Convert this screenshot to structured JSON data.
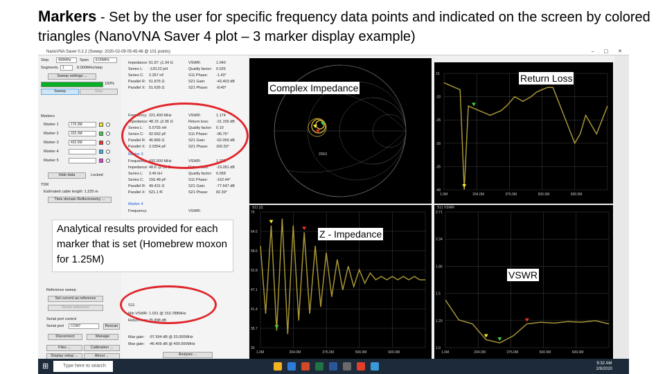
{
  "slide": {
    "title_bold": "Markers",
    "title_rest": " - Set by the user for specific frequency data points and indicated on the screen by colored triangles (NanoVNA Saver 4 plot – 3 marker display example)"
  },
  "window": {
    "title": "NanoVNA Saver 0.2.2 (Sweep: 2020-02-09 05:45:48 @ 101 points)",
    "controls": "– ▢ ✕"
  },
  "sweep_panel": {
    "stop_label": "Stop",
    "stop_value": "400MHz",
    "span_label": "Span",
    "span_value": "8.00MHz",
    "segments_label": "Segments",
    "segments_value": "1",
    "segment_info": "8.000MHz/step",
    "settings_button": "Sweep settings ...",
    "progress": "100%",
    "sweep_button": "Sweep",
    "stop_button": "Stop"
  },
  "markers_panel": {
    "title": "Markers",
    "items": [
      {
        "label": "Marker 1",
        "value": "170.3M",
        "color": "#f5e82a"
      },
      {
        "label": "Marker 2",
        "value": "222.3M",
        "color": "#3fd04a"
      },
      {
        "label": "Marker 3",
        "value": "432.5M",
        "color": "#e8352b"
      },
      {
        "label": "Marker 4",
        "value": "",
        "color": "#29b8e8"
      },
      {
        "label": "Marker 5",
        "value": "",
        "color": "#e83bd5"
      }
    ],
    "hide_button": "Hide data",
    "locked_label": "Locked"
  },
  "tdr_panel": {
    "title": "TDR",
    "cable_label": "Estimated cable length: 1.225 m",
    "time_button": "Time domain Reflectometry ..."
  },
  "reference_panel": {
    "title": "Reference sweep",
    "set_button": "Set current as reference",
    "reset_button": "Reset reference"
  },
  "serial_panel": {
    "title": "Serial port control",
    "port_label": "Serial port",
    "port_value": "COM7",
    "rescan_button": "Rescan",
    "disconnect_button": "Disconnect",
    "manage_button": "Manage"
  },
  "bottom_buttons": {
    "files": "Files ...",
    "calibration": "Calibration ...",
    "display": "Display setup ...",
    "about": "About ...",
    "analysis": "Analysis ..."
  },
  "marker_data": {
    "block1": [
      [
        "Impedance:",
        "51.87 -j1.34 Ω",
        "VSWR:",
        "1.040"
      ],
      [
        "Series L:",
        "-120.22 pH",
        "Quality factor:",
        "0.026"
      ],
      [
        "Series C:",
        "2.267 nF",
        "S11 Phase:",
        "-1.43°"
      ],
      [
        "Parallel R:",
        "51.876 Ω",
        "S21 Gain:",
        "-43.403 dB"
      ],
      [
        "Parallel X:",
        "51.626 Ω",
        "S21 Phase:",
        "-8.40°"
      ]
    ],
    "block2": [
      [
        "Frequency:",
        "221.400 MHz",
        "VSWR:",
        "1.174"
      ],
      [
        "Impedance:",
        "48.15 -j2.36 Ω",
        "Return loss:",
        "-21.156 dB"
      ],
      [
        "Series L:",
        "5.5755 nH",
        "Quality factor:",
        "0.10"
      ],
      [
        "Series C:",
        "92.662 pF",
        "S11 Phase:",
        "-96.76°"
      ],
      [
        "Parallel R:",
        "46.866 Ω",
        "S21 Gain:",
        "-52.056 dB"
      ],
      [
        "Parallel X:",
        "2.0354 pF",
        "S21 Phase:",
        "166.53°"
      ]
    ],
    "marker3_title": "Marker 3",
    "block3": [
      [
        "Frequency:",
        "432.500 MHz",
        "VSWR:",
        "1.235"
      ],
      [
        "Impedance:",
        "48.6 -j2.10 Ω",
        "Return loss:",
        "-19.281 dB"
      ],
      [
        "Series L:",
        "3.46 kH",
        "Quality factor:",
        "0.058"
      ],
      [
        "Series C:",
        "156.48 pF",
        "S11 Phase:",
        "-162.44°"
      ],
      [
        "Parallel R:",
        "49.431 Ω",
        "S21 Gain:",
        "-77.647 dB"
      ],
      [
        "Parallel X:",
        "521.1 fF",
        "S21 Phase:",
        "82.39°"
      ]
    ],
    "marker4_title": "Marker 4",
    "marker4_freq": "Frequency:",
    "marker4_vswr": "VSWR:",
    "s11_title": "S11",
    "min_vswr_label": "Min VSWR:",
    "min_vswr_value": "1.031 @ 153.788MHz",
    "return_loss_label": "Return loss:",
    "return_loss_value": "35.898 dB",
    "max_gain_label": "Max gain:",
    "max_gain_value": "-97.594 dB @ 20.000MHz",
    "max_gain2_value": "-46.406 dB @ 400.000MHz"
  },
  "callout": {
    "text": "Analytical results provided for each marker that is set (Homebrew moxon for 1.25M)"
  },
  "charts": {
    "complex_impedance_label": "Complex Impedance",
    "return_loss_label": "Return Loss",
    "z_impedance_label": "Z - Impedance",
    "vswr_label": "VSWR",
    "s11_vswr_title": "S11 VSWR",
    "s11_z_title": "S11 |Z|",
    "x_ticks": [
      "1.0M",
      "204.0M",
      "375.0M",
      "500.0M",
      "600.0M"
    ],
    "return_loss_y": [
      "15",
      "-20",
      "-25",
      "-30",
      "-35",
      "-40"
    ],
    "impedance_y": [
      "70",
      "64.5",
      "58.6",
      "52.8",
      "47.1",
      "41.4",
      "35.7",
      "30"
    ],
    "vswr_y": [
      "2.71",
      "2.34",
      "1.86",
      "1.5",
      "1.29",
      "1.0"
    ],
    "smith_label": "200Ω"
  },
  "taskbar": {
    "search_placeholder": "Type here to search",
    "time": "9:32 AM",
    "date": "2/9/2020"
  },
  "chart_data": [
    {
      "type": "line",
      "title": "Return Loss",
      "x": [
        1,
        20,
        40,
        60,
        75,
        90,
        110,
        130,
        150,
        170,
        190,
        210,
        230,
        260,
        290,
        320,
        340,
        360,
        380,
        400,
        420,
        440,
        460,
        480,
        500,
        520,
        540,
        560,
        580,
        600
      ],
      "series": [
        {
          "values": [
            -17,
            -17.5,
            -18,
            -18.5,
            -40,
            -22,
            -22.5,
            -23,
            -23.5,
            -24,
            -23.5,
            -23,
            -22,
            -20,
            -21,
            -20,
            -19,
            -18.5,
            -18,
            -18,
            -21,
            -24,
            -27,
            -30,
            -28,
            -24,
            -26,
            -28,
            -25,
            -22
          ]
        }
      ],
      "ylim": [
        -40,
        -15
      ]
    },
    {
      "type": "line",
      "title": "Z - Impedance",
      "x": [
        1,
        20,
        40,
        60,
        80,
        100,
        120,
        140,
        160,
        180,
        200,
        220,
        240,
        260,
        280,
        300,
        320,
        340,
        360,
        380,
        400,
        420,
        440,
        460,
        480,
        500,
        520,
        540,
        560,
        580,
        600
      ],
      "series": [
        {
          "values": [
            60,
            40,
            66,
            35,
            68,
            34,
            66,
            38,
            64,
            40,
            60,
            42,
            58,
            45,
            56,
            47,
            54,
            48,
            53,
            49,
            52,
            50,
            51,
            50,
            51,
            50,
            51,
            50,
            51,
            50,
            50
          ]
        }
      ],
      "ylim": [
        30,
        70
      ]
    },
    {
      "type": "line",
      "title": "VSWR",
      "x": [
        1,
        50,
        100,
        150,
        200,
        250,
        300,
        350,
        400,
        450,
        500,
        550,
        600
      ],
      "series": [
        {
          "values": [
            1.6,
            1.35,
            1.3,
            1.1,
            1.06,
            1.15,
            1.3,
            1.32,
            1.31,
            1.33,
            1.32,
            1.34,
            1.3
          ]
        }
      ],
      "ylim": [
        1.0,
        2.71
      ]
    }
  ]
}
